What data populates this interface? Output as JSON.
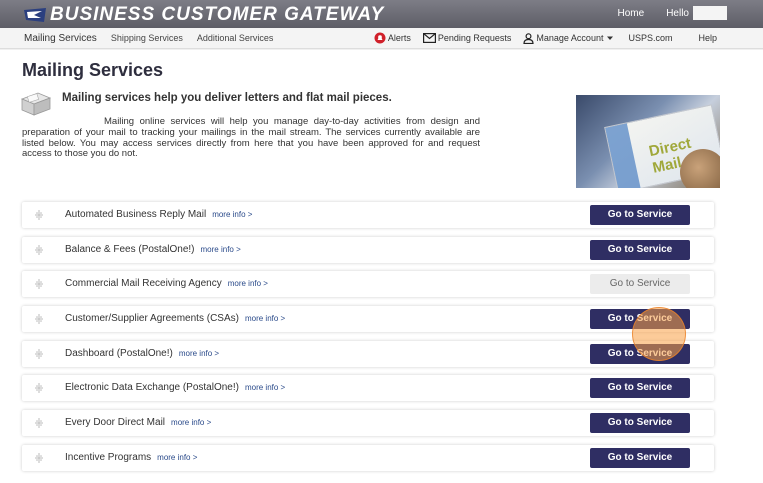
{
  "header": {
    "brand": "BUSINESS CUSTOMER GATEWAY",
    "home_label": "Home",
    "hello_label": "Hello"
  },
  "nav": {
    "left": [
      "Mailing Services",
      "Shipping Services",
      "Additional Services"
    ],
    "alerts_label": "Alerts",
    "pending_label": "Pending Requests",
    "manage_label": "Manage Account",
    "usps_label": "USPS.com",
    "help_label": "Help"
  },
  "page": {
    "title": "Mailing Services",
    "headline": "Mailing services help you deliver letters and flat mail pieces.",
    "description": "Mailing online services will help you manage day-to-day activities from design and preparation of your mail to tracking your mailings in the mail stream. The services currently available are listed below. You may access services directly from here that you have been approved for and request access to those you do not.",
    "photo_text": "Direct Mail"
  },
  "services": [
    {
      "name": "Automated Business Reply Mail",
      "more": "more info >",
      "button": "Go to Service",
      "enabled": true
    },
    {
      "name": "Balance & Fees (PostalOne!)",
      "more": "more info >",
      "button": "Go to Service",
      "enabled": true
    },
    {
      "name": "Commercial Mail Receiving Agency",
      "more": "more info >",
      "button": "Go to Service",
      "enabled": false
    },
    {
      "name": "Customer/Supplier Agreements (CSAs)",
      "more": "more info >",
      "button": "Go to Service",
      "enabled": true
    },
    {
      "name": "Dashboard (PostalOne!)",
      "more": "more info >",
      "button": "Go to Service",
      "enabled": true
    },
    {
      "name": "Electronic Data Exchange (PostalOne!)",
      "more": "more info >",
      "button": "Go to Service",
      "enabled": true
    },
    {
      "name": "Every Door Direct Mail",
      "more": "more info >",
      "button": "Go to Service",
      "enabled": true
    },
    {
      "name": "Incentive Programs",
      "more": "more info >",
      "button": "Go to Service",
      "enabled": true
    }
  ],
  "colors": {
    "primary_button": "#2f2e63",
    "alert_badge": "#d0202a",
    "header_bg": "#6b6b74"
  }
}
